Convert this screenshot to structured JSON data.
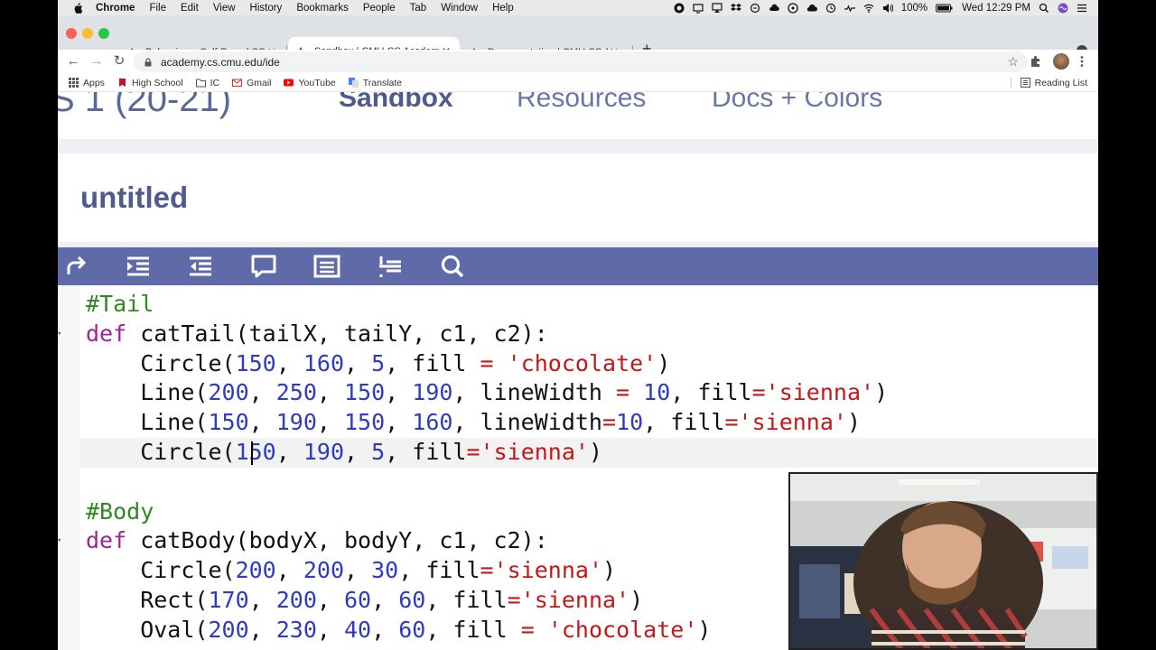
{
  "menubar": {
    "items": [
      "Chrome",
      "File",
      "Edit",
      "View",
      "History",
      "Bookmarks",
      "People",
      "Tab",
      "Window",
      "Help"
    ],
    "battery": "100%",
    "clock": "Wed 12:29 PM"
  },
  "tabs": [
    {
      "title": "Balancing a Self-Paced CS Cla",
      "active": false
    },
    {
      "title": "Sandbox | CMU CS Academy",
      "active": true
    },
    {
      "title": "Documentation | CMU CS Acad",
      "active": false
    }
  ],
  "newtab_symbol": "+",
  "close_symbol": "✕",
  "toolbar": {
    "url": "academy.cs.cmu.edu/ide",
    "back": "←",
    "forward": "→",
    "reload": "↻",
    "star": "☆"
  },
  "bookmarks": [
    {
      "label": "Apps",
      "icon": "apps-grid-icon"
    },
    {
      "label": "High School",
      "icon": "bookmark-icon"
    },
    {
      "label": "IC",
      "icon": "folder-icon"
    },
    {
      "label": "Gmail",
      "icon": "gmail-icon"
    },
    {
      "label": "YouTube",
      "icon": "youtube-icon"
    },
    {
      "label": "Translate",
      "icon": "translate-icon"
    }
  ],
  "reading_list": "Reading List",
  "site_nav": {
    "brand": "S 1 (20-21)",
    "links": [
      "Sandbox",
      "Resources",
      "Docs + Colors"
    ],
    "active": "Sandbox"
  },
  "project_title": "untitled",
  "editor_tools": [
    "run-redo-icon",
    "indent-icon",
    "outdent-icon",
    "comment-icon",
    "document-icon",
    "format-icon",
    "search-icon"
  ],
  "colors": {
    "brand": "#5f6aa8",
    "keyword": "#a0229a",
    "comment": "#2d8a1f",
    "number": "#2e3bbf",
    "string": "#c21818"
  },
  "code": [
    {
      "folded": false,
      "segments": [
        {
          "t": "#Tail",
          "c": "c"
        }
      ]
    },
    {
      "folded": true,
      "segments": [
        {
          "t": "def",
          "c": "k"
        },
        {
          "t": " catTail(tailX, tailY, c1, c2):",
          "c": ""
        }
      ]
    },
    {
      "folded": false,
      "segments": [
        {
          "t": "    Circle(",
          "c": ""
        },
        {
          "t": "150",
          "c": "n"
        },
        {
          "t": ", ",
          "c": ""
        },
        {
          "t": "160",
          "c": "n"
        },
        {
          "t": ", ",
          "c": ""
        },
        {
          "t": "5",
          "c": "n"
        },
        {
          "t": ", fill ",
          "c": ""
        },
        {
          "t": "=",
          "c": "o"
        },
        {
          "t": " ",
          "c": ""
        },
        {
          "t": "'chocolate'",
          "c": "s"
        },
        {
          "t": ")",
          "c": ""
        }
      ]
    },
    {
      "folded": false,
      "segments": [
        {
          "t": "    Line(",
          "c": ""
        },
        {
          "t": "200",
          "c": "n"
        },
        {
          "t": ", ",
          "c": ""
        },
        {
          "t": "250",
          "c": "n"
        },
        {
          "t": ", ",
          "c": ""
        },
        {
          "t": "150",
          "c": "n"
        },
        {
          "t": ", ",
          "c": ""
        },
        {
          "t": "190",
          "c": "n"
        },
        {
          "t": ", lineWidth ",
          "c": ""
        },
        {
          "t": "=",
          "c": "o"
        },
        {
          "t": " ",
          "c": ""
        },
        {
          "t": "10",
          "c": "n"
        },
        {
          "t": ", fill",
          "c": ""
        },
        {
          "t": "=",
          "c": "o"
        },
        {
          "t": "'sienna'",
          "c": "s"
        },
        {
          "t": ")",
          "c": ""
        }
      ]
    },
    {
      "folded": false,
      "segments": [
        {
          "t": "    Line(",
          "c": ""
        },
        {
          "t": "150",
          "c": "n"
        },
        {
          "t": ", ",
          "c": ""
        },
        {
          "t": "190",
          "c": "n"
        },
        {
          "t": ", ",
          "c": ""
        },
        {
          "t": "150",
          "c": "n"
        },
        {
          "t": ", ",
          "c": ""
        },
        {
          "t": "160",
          "c": "n"
        },
        {
          "t": ", lineWidth",
          "c": ""
        },
        {
          "t": "=",
          "c": "o"
        },
        {
          "t": "10",
          "c": "n"
        },
        {
          "t": ", fill",
          "c": ""
        },
        {
          "t": "=",
          "c": "o"
        },
        {
          "t": "'sienna'",
          "c": "s"
        },
        {
          "t": ")",
          "c": ""
        }
      ]
    },
    {
      "folded": false,
      "segments": [
        {
          "t": "    Circle(",
          "c": ""
        },
        {
          "t": "150",
          "c": "n"
        },
        {
          "t": ", ",
          "c": ""
        },
        {
          "t": "190",
          "c": "n"
        },
        {
          "t": ", ",
          "c": ""
        },
        {
          "t": "5",
          "c": "n"
        },
        {
          "t": ", fill",
          "c": ""
        },
        {
          "t": "=",
          "c": "o"
        },
        {
          "t": "'sienna'",
          "c": "s"
        },
        {
          "t": ")",
          "c": ""
        }
      ]
    },
    {
      "folded": false,
      "segments": [
        {
          "t": "",
          "c": ""
        }
      ]
    },
    {
      "folded": false,
      "segments": [
        {
          "t": "#Body",
          "c": "c"
        }
      ]
    },
    {
      "folded": true,
      "segments": [
        {
          "t": "def",
          "c": "k"
        },
        {
          "t": " catBody(bodyX, bodyY, c1, c2):",
          "c": ""
        }
      ]
    },
    {
      "folded": false,
      "segments": [
        {
          "t": "    Circle(",
          "c": ""
        },
        {
          "t": "200",
          "c": "n"
        },
        {
          "t": ", ",
          "c": ""
        },
        {
          "t": "200",
          "c": "n"
        },
        {
          "t": ", ",
          "c": ""
        },
        {
          "t": "30",
          "c": "n"
        },
        {
          "t": ", fill",
          "c": ""
        },
        {
          "t": "=",
          "c": "o"
        },
        {
          "t": "'sienna'",
          "c": "s"
        },
        {
          "t": ")",
          "c": ""
        }
      ]
    },
    {
      "folded": false,
      "segments": [
        {
          "t": "    Rect(",
          "c": ""
        },
        {
          "t": "170",
          "c": "n"
        },
        {
          "t": ", ",
          "c": ""
        },
        {
          "t": "200",
          "c": "n"
        },
        {
          "t": ", ",
          "c": ""
        },
        {
          "t": "60",
          "c": "n"
        },
        {
          "t": ", ",
          "c": ""
        },
        {
          "t": "60",
          "c": "n"
        },
        {
          "t": ", fill",
          "c": ""
        },
        {
          "t": "=",
          "c": "o"
        },
        {
          "t": "'sienna'",
          "c": "s"
        },
        {
          "t": ")",
          "c": ""
        }
      ]
    },
    {
      "folded": false,
      "segments": [
        {
          "t": "    Oval(",
          "c": ""
        },
        {
          "t": "200",
          "c": "n"
        },
        {
          "t": ", ",
          "c": ""
        },
        {
          "t": "230",
          "c": "n"
        },
        {
          "t": ", ",
          "c": ""
        },
        {
          "t": "40",
          "c": "n"
        },
        {
          "t": ", ",
          "c": ""
        },
        {
          "t": "60",
          "c": "n"
        },
        {
          "t": ", fill ",
          "c": ""
        },
        {
          "t": "=",
          "c": "o"
        },
        {
          "t": " ",
          "c": ""
        },
        {
          "t": "'chocolate'",
          "c": "s"
        },
        {
          "t": ")",
          "c": ""
        }
      ]
    }
  ]
}
